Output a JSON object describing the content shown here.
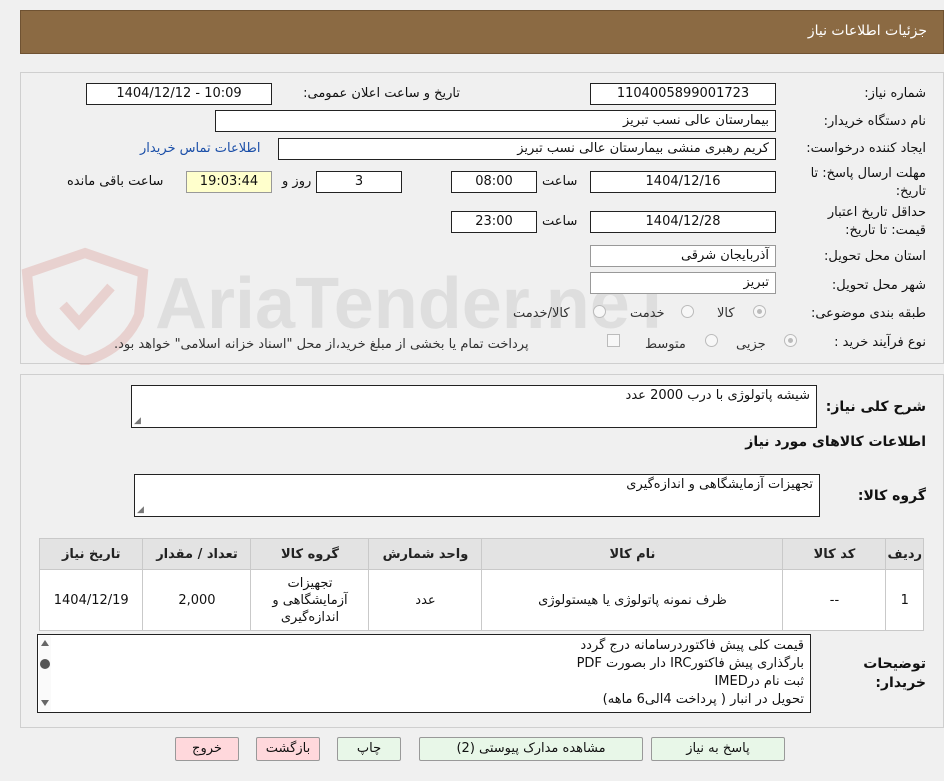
{
  "header": {
    "title": "جزئیات اطلاعات نیاز"
  },
  "watermark": {
    "text": "AriaTender.neT"
  },
  "form": {
    "need_number_label": "شماره نیاز:",
    "need_number": "1104005899001723",
    "announce_label": "تاریخ و ساعت اعلان عمومی:",
    "announce_value": "1404/12/12 - 10:09",
    "buyer_org_label": "نام دستگاه خریدار:",
    "buyer_org": "بیمارستان عالی نسب تبریز",
    "requester_label": "ایجاد کننده درخواست:",
    "requester": "کریم رهبری منشی بیمارستان عالی نسب تبریز",
    "contact_link": "اطلاعات تماس خریدار",
    "deadline_label_1": "مهلت ارسال پاسخ: تا",
    "deadline_label_2": "تاریخ:",
    "deadline_date": "1404/12/16",
    "time_label": "ساعت",
    "deadline_time": "08:00",
    "days_value": "3",
    "days_label": "روز و",
    "remaining_time": "19:03:44",
    "remaining_label": "ساعت باقی مانده",
    "validity_label_1": "حداقل تاریخ اعتبار",
    "validity_label_2": "قیمت: تا تاریخ:",
    "validity_date": "1404/12/28",
    "validity_time_label": "ساعت",
    "validity_time": "23:00",
    "province_label": "استان محل تحویل:",
    "province": "آذربایجان شرقی",
    "city_label": "شهر محل تحویل:",
    "city": "تبریز",
    "category_label": "طبقه بندی موضوعی:",
    "category_options": [
      "کالا",
      "خدمت",
      "کالا/خدمت"
    ],
    "process_label": "نوع فرآیند خرید :",
    "process_options": [
      "جزیی",
      "متوسط"
    ],
    "payment_note": "پرداخت تمام یا بخشی از مبلغ خرید،از محل \"اسناد خزانه اسلامی\" خواهد بود."
  },
  "summary": {
    "label": "شرح کلی نیاز:",
    "value": "شیشه پاتولوژی با درب 2000 عدد",
    "goods_info_title": "اطلاعات کالاهای مورد نیاز",
    "goods_group_label": "گروه کالا:",
    "goods_group_value": "تجهیزات آزمایشگاهی و اندازه‌گیری"
  },
  "table": {
    "headers": [
      "ردیف",
      "کد کالا",
      "نام کالا",
      "واحد شمارش",
      "گروه کالا",
      "تعداد / مقدار",
      "تاریخ نیاز"
    ],
    "rows": [
      {
        "row": "1",
        "code": "--",
        "name": "ظرف نمونه پاتولوژی یا هیستولوژی",
        "unit": "عدد",
        "group_lines": [
          "تجهیزات",
          "آزمایشگاهی و",
          "اندازه‌گیری"
        ],
        "quantity": "2,000",
        "date": "1404/12/19"
      }
    ]
  },
  "notes": {
    "label_1": "توضیحات",
    "label_2": "خریدار:",
    "lines": [
      "قیمت کلی پیش فاکتوردرسامانه درج گردد",
      "بارگذاری پیش فاکتورIRC دار بصورت PDF",
      "ثبت نام درIMED",
      "تحویل در انبار ( پرداخت 4الی6 ماهه)"
    ]
  },
  "buttons": {
    "reply": "پاسخ به نیاز",
    "attachments": "مشاهده مدارک پیوستی (2)",
    "print": "چاپ",
    "back": "بازگشت",
    "exit": "خروج"
  }
}
